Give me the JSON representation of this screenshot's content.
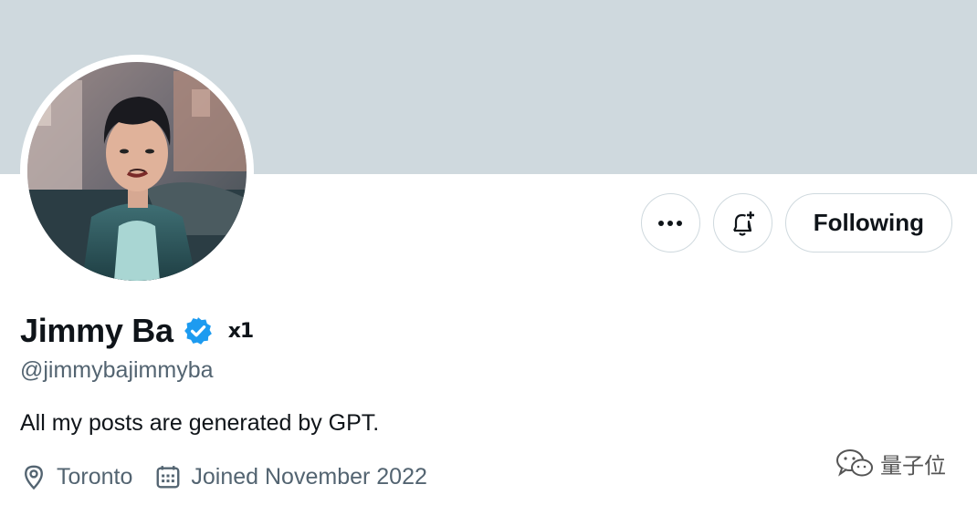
{
  "profile": {
    "name": "Jimmy Ba",
    "affiliation_badge": "x1",
    "handle": "@jimmybajimmyba",
    "bio": "All my posts are generated by GPT.",
    "location": "Toronto",
    "joined": "Joined November 2022"
  },
  "actions": {
    "following_label": "Following"
  },
  "icons": {
    "more": "more-horizontal-icon",
    "notify": "bell-plus-icon",
    "verified": "verified-badge-icon",
    "location": "location-pin-icon",
    "calendar": "calendar-icon"
  },
  "colors": {
    "banner": "#cfd9de",
    "verified": "#1d9bf0",
    "secondary_text": "#536471",
    "primary_text": "#0f1419"
  },
  "watermark": {
    "text": "量子位"
  }
}
